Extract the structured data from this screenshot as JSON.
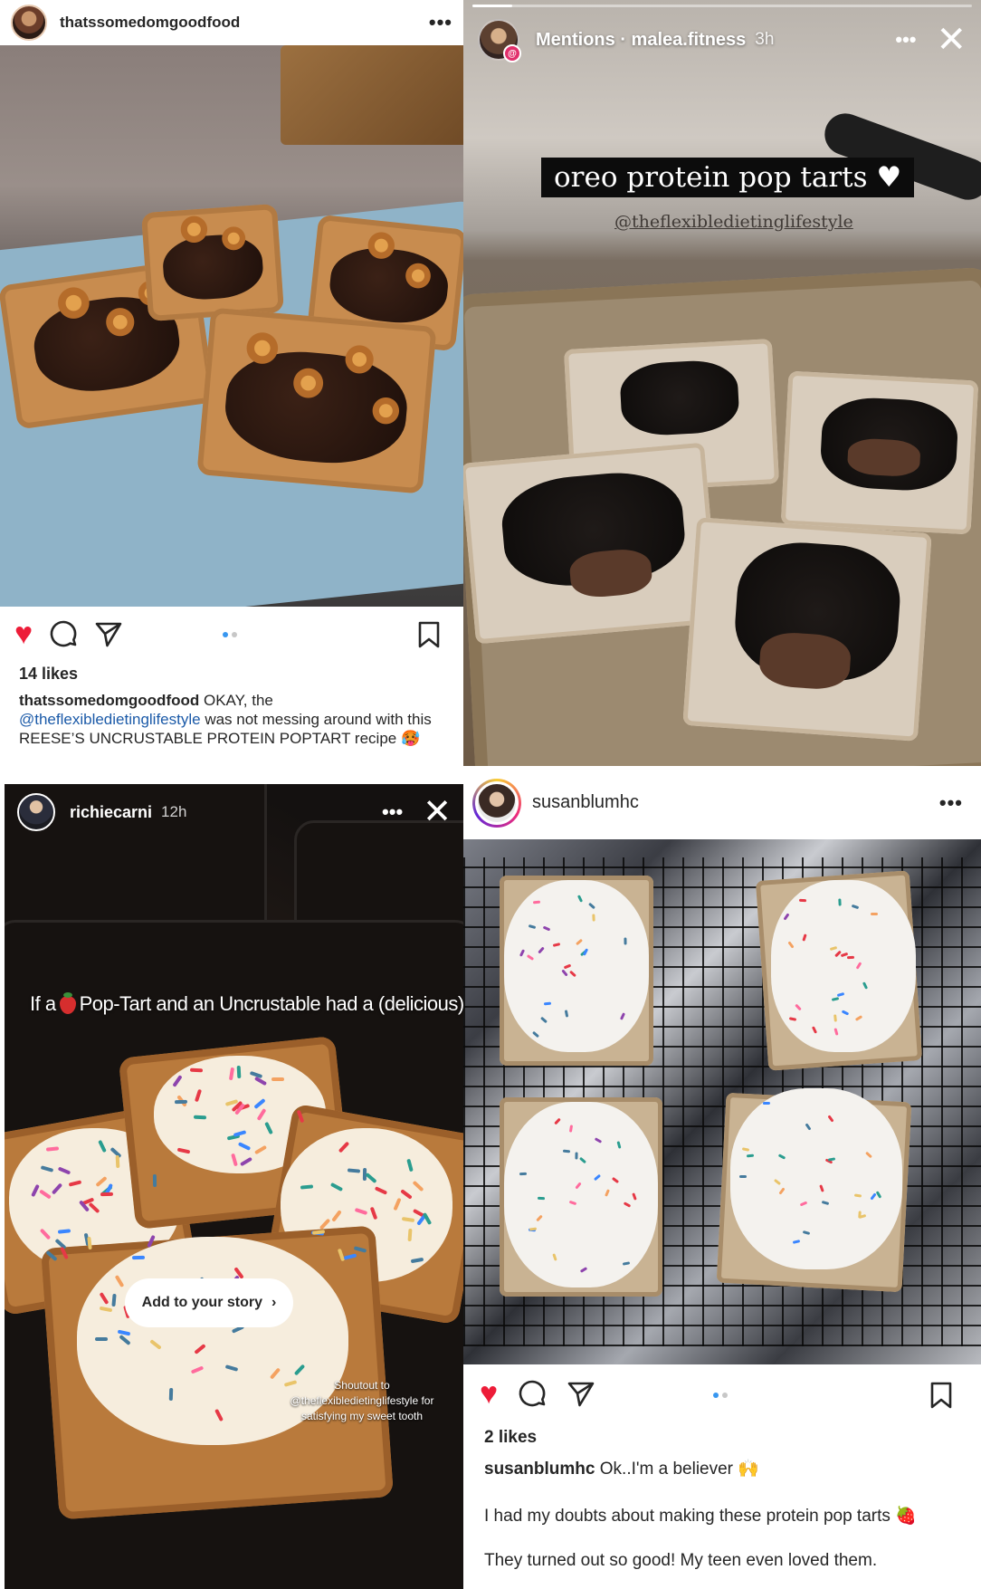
{
  "post1": {
    "username": "thatssomedomgoodfood",
    "more": "•••",
    "likes": "14 likes",
    "caption_user": "thatssomedomgoodfood",
    "caption_text1": " OKAY, the",
    "caption_mention": "@theflexibledietinglifestyle",
    "caption_text2": " was not messing around with this REESE’S UNCRUSTABLE PROTEIN POPTART recipe 🥵",
    "icons": [
      "heart-icon",
      "comment-icon",
      "share-icon",
      "bookmark-icon"
    ]
  },
  "story1": {
    "title": "Mentions · malea.fitness",
    "time": "3h",
    "more": "•••",
    "close": "✕",
    "overlay_text": "oreo protein pop tarts ♥",
    "overlay_mention": "@theflexibledietinglifestyle"
  },
  "story2": {
    "username": "richiecarni",
    "time": "12h",
    "more": "•••",
    "close": "✕",
    "overlay_before": "If a",
    "overlay_after": "Pop-Tart and an Uncrustable had a (delicious) baby",
    "add_story": "Add to your story",
    "shoutout_line1": "Shoutout to",
    "shoutout_line2": "@theflexibledietinglifestyle for",
    "shoutout_line3": "satisfying my sweet tooth"
  },
  "post2": {
    "username": "susanblumhc",
    "more": "•••",
    "likes": "2 likes",
    "caption_user": "susanblumhc",
    "caption_text": " Ok..I'm a believer 🙌",
    "caption_p2": "I had my doubts about making these protein pop tarts 🍓",
    "caption_p3": "They turned out so good! My teen even loved them."
  },
  "colors": {
    "like": "#ed1c38",
    "mention": "#1b5aa8",
    "dot_active": "#3897f0"
  }
}
